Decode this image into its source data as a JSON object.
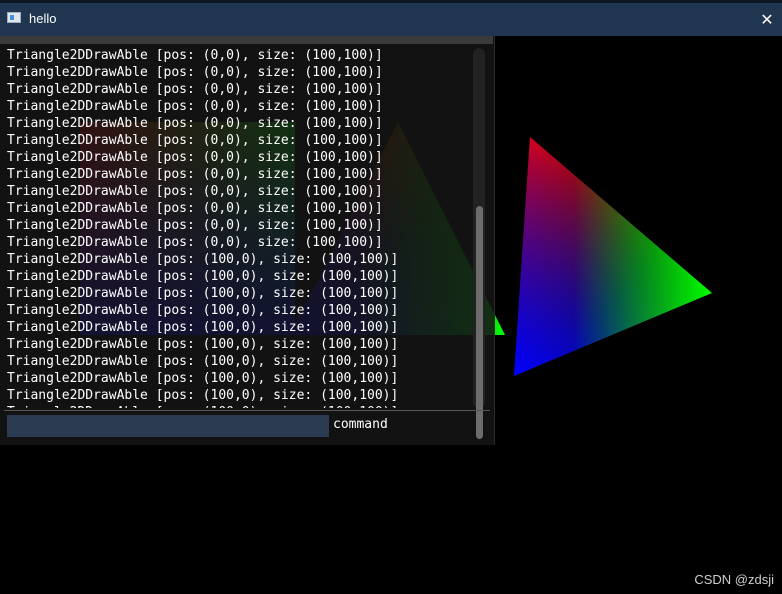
{
  "window": {
    "title": "hello",
    "close_glyph": "✕"
  },
  "console": {
    "lines": [
      "Triangle2DDrawAble [pos: (0,0), size: (100,100)]",
      "Triangle2DDrawAble [pos: (0,0), size: (100,100)]",
      "Triangle2DDrawAble [pos: (0,0), size: (100,100)]",
      "Triangle2DDrawAble [pos: (0,0), size: (100,100)]",
      "Triangle2DDrawAble [pos: (0,0), size: (100,100)]",
      "Triangle2DDrawAble [pos: (0,0), size: (100,100)]",
      "Triangle2DDrawAble [pos: (0,0), size: (100,100)]",
      "Triangle2DDrawAble [pos: (0,0), size: (100,100)]",
      "Triangle2DDrawAble [pos: (0,0), size: (100,100)]",
      "Triangle2DDrawAble [pos: (0,0), size: (100,100)]",
      "Triangle2DDrawAble [pos: (0,0), size: (100,100)]",
      "Triangle2DDrawAble [pos: (0,0), size: (100,100)]",
      "Triangle2DDrawAble [pos: (100,0), size: (100,100)]",
      "Triangle2DDrawAble [pos: (100,0), size: (100,100)]",
      "Triangle2DDrawAble [pos: (100,0), size: (100,100)]",
      "Triangle2DDrawAble [pos: (100,0), size: (100,100)]",
      "Triangle2DDrawAble [pos: (100,0), size: (100,100)]",
      "Triangle2DDrawAble [pos: (100,0), size: (100,100)]",
      "Triangle2DDrawAble [pos: (100,0), size: (100,100)]",
      "Triangle2DDrawAble [pos: (100,0), size: (100,100)]",
      "Triangle2DDrawAble [pos: (100,0), size: (100,100)]",
      "Triangle2DDrawAble [pos: (100,0), size: (100,100)]"
    ],
    "command_value": "",
    "command_label": "command"
  },
  "watermark": "CSDN @zdsji",
  "colors": {
    "titlebar": "#1f3550",
    "console_bg": "#141414",
    "input_bg": "#2b3b52",
    "vertex_red": "#ff0000",
    "vertex_green": "#00ff00",
    "vertex_blue": "#0000ff"
  }
}
